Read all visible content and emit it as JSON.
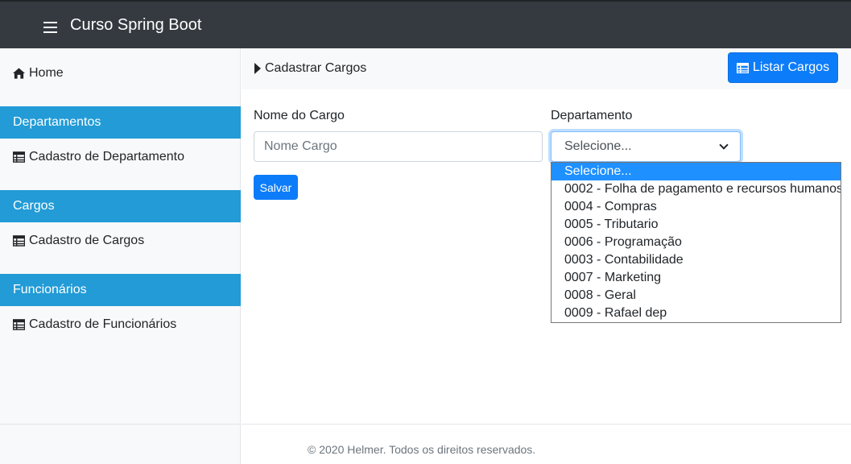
{
  "navbar": {
    "brand": "Curso Spring Boot"
  },
  "sidebar": {
    "home": "Home",
    "sections": [
      {
        "header": "Departamentos",
        "link": "Cadastro de Departamento"
      },
      {
        "header": "Cargos",
        "link": "Cadastro de Cargos"
      },
      {
        "header": "Funcionários",
        "link": "Cadastro de Funcionários"
      }
    ]
  },
  "page": {
    "breadcrumb": "Cadastrar Cargos",
    "list_button": "Listar Cargos"
  },
  "form": {
    "nome_label": "Nome do Cargo",
    "nome_placeholder": "Nome Cargo",
    "dep_label": "Departamento",
    "dep_selected": "Selecione...",
    "save_button": "Salvar",
    "options": [
      "Selecione...",
      "0002 - Folha de pagamento e recursos humanos",
      "0004 - Compras",
      "0005 - Tributario",
      "0006 - Programação",
      "0003 - Contabilidade",
      "0007 - Marketing",
      "0008 - Geral",
      "0009 - Rafael dep"
    ]
  },
  "footer": {
    "copyright": "© 2020 Helmer. Todos os direitos reservados."
  },
  "colors": {
    "navbar": "#343a40",
    "sidebar_header": "#229bd6",
    "primary": "#0d7cf9",
    "selected_option": "#1e90ff"
  }
}
